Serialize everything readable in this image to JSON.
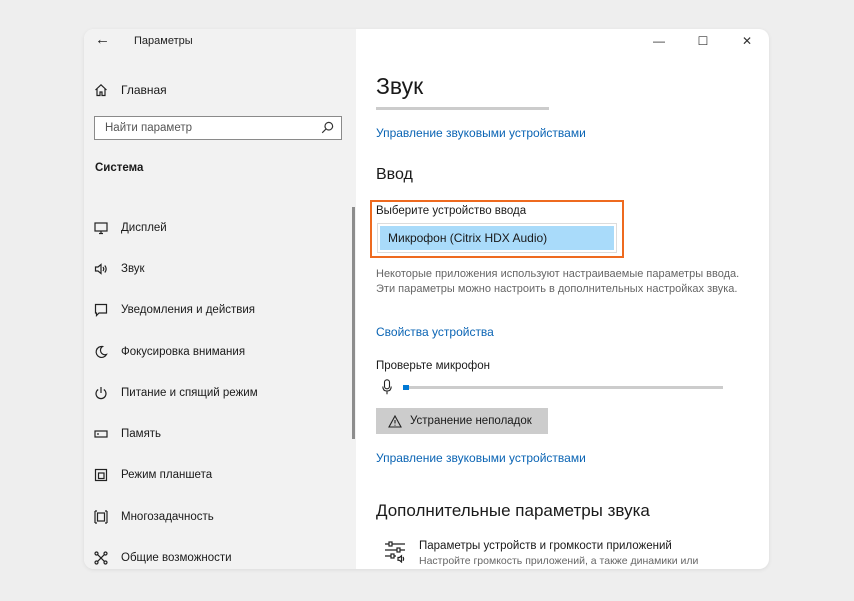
{
  "window": {
    "title": "Параметры",
    "controls": {
      "minimize": "—",
      "maximize": "☐",
      "close": "✕"
    }
  },
  "sidebar": {
    "home_label": "Главная",
    "search_placeholder": "Найти параметр",
    "section_title": "Система",
    "items": [
      {
        "label": "Дисплей",
        "icon": "display-icon"
      },
      {
        "label": "Звук",
        "icon": "speaker-icon"
      },
      {
        "label": "Уведомления и действия",
        "icon": "notification-icon"
      },
      {
        "label": "Фокусировка внимания",
        "icon": "moon-icon"
      },
      {
        "label": "Питание и спящий режим",
        "icon": "power-icon"
      },
      {
        "label": "Память",
        "icon": "storage-icon"
      },
      {
        "label": "Режим планшета",
        "icon": "tablet-icon"
      },
      {
        "label": "Многозадачность",
        "icon": "multitasking-icon"
      },
      {
        "label": "Общие возможности",
        "icon": "shared-experiences-icon"
      }
    ]
  },
  "content": {
    "page_title": "Звук",
    "manage_devices_link_top": "Управление звуковыми устройствами",
    "input_heading": "Ввод",
    "choose_device_label": "Выберите устройство ввода",
    "selected_device": "Микрофон (Citrix HDX Audio)",
    "description": "Некоторые приложения используют настраиваемые параметры ввода. Эти параметры можно настроить в дополнительных настройках звука.",
    "device_properties_link": "Свойства устройства",
    "test_mic_label": "Проверьте микрофон",
    "mic_level_percent": 2,
    "troubleshoot_label": "Устранение неполадок",
    "manage_devices_link_bottom": "Управление звуковыми устройствами",
    "advanced_heading": "Дополнительные параметры звука",
    "app_volume_title": "Параметры устройств и громкости приложений",
    "app_volume_desc": "Настройте громкость приложений, а также динамики или"
  },
  "colors": {
    "accent_link": "#0a64b4",
    "highlight_border": "#ee6a1f",
    "selected_bg": "#a9dbfa",
    "level_fill": "#0078d4"
  }
}
